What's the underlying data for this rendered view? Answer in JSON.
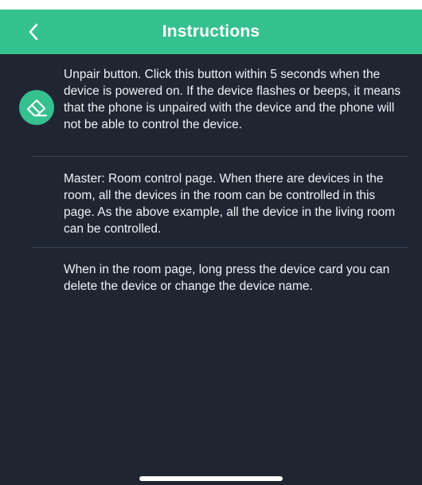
{
  "header": {
    "title": "Instructions",
    "back_icon": "chevron-left-icon",
    "color": "#35c08f"
  },
  "instructions": [
    {
      "icon": "eraser-icon",
      "text": "Unpair button. Click this button within 5 seconds when the device is powered on. If the device flashes or beeps, it means that the phone is unpaired with the device and the phone will not be able to control the device."
    },
    {
      "text": "Master: Room control page. When there are devices in the room, all the devices in the room can be controlled in this page. As the above example, all the device in the living room can be controlled."
    },
    {
      "text": "When in the room page, long press the device card you can delete the device or change the device name."
    }
  ],
  "colors": {
    "background": "#202532",
    "accent": "#35c08f",
    "text": "#f0f2f5"
  }
}
